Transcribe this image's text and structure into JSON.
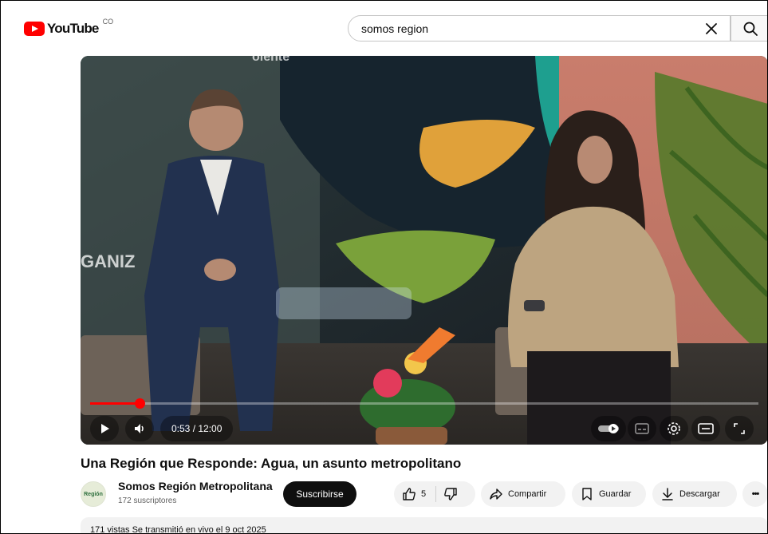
{
  "header": {
    "logo_text": "YouTube",
    "logo_sup": "CO",
    "search_value": "somos region",
    "icons": [
      "youtube-logo-icon",
      "clear-icon",
      "search-icon"
    ]
  },
  "player": {
    "time_display": "0:53 / 12:00",
    "progress": 0.0736,
    "icons": [
      "play-icon",
      "volume-icon",
      "autoplay-toggle-icon",
      "subtitles-icon",
      "settings-icon",
      "theater-mode-icon",
      "fullscreen-icon"
    ]
  },
  "video": {
    "title": "Una Región que Responde: Agua, un asunto metropolitano"
  },
  "channel": {
    "name": "Somos Región Metropolitana",
    "subscribers": "172 suscriptores",
    "avatar_text": "Región",
    "subscribe_label": "Suscribirse"
  },
  "actions": {
    "like_count": "5",
    "share_label": "Compartir",
    "save_label": "Guardar",
    "download_label": "Descargar",
    "more_label": "•••"
  },
  "description": {
    "text": "171 vistas  Se transmitió en vivo el 9 oct 2025"
  },
  "colors": {
    "brand_red": "#ff0000",
    "subscribe_bg": "#0f0f0f",
    "chip_bg": "#f2f2f2"
  }
}
